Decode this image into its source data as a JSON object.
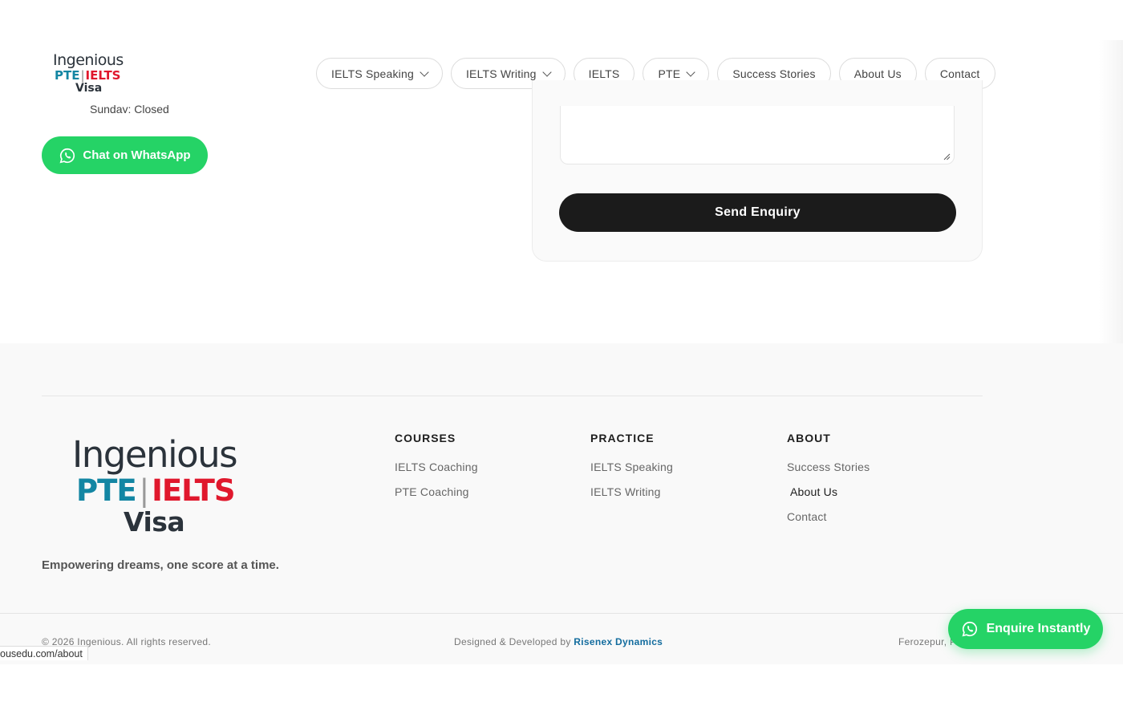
{
  "brand": {
    "line1": "Ingenious",
    "pte": "PTE",
    "separator": "|",
    "ielts": "IELTS",
    "line3": "Visa"
  },
  "nav": {
    "items": [
      {
        "label": "IELTS Speaking",
        "dropdown": true
      },
      {
        "label": "IELTS Writing",
        "dropdown": true
      },
      {
        "label": "IELTS",
        "dropdown": false
      },
      {
        "label": "PTE",
        "dropdown": true
      },
      {
        "label": "Success Stories",
        "dropdown": false
      },
      {
        "label": "About Us",
        "dropdown": false
      },
      {
        "label": "Contact",
        "dropdown": false
      }
    ]
  },
  "contact": {
    "hours_sunday": "Sunday: Closed",
    "whatsapp_label": "Chat on WhatsApp"
  },
  "form": {
    "message_value": "",
    "submit_label": "Send Enquiry"
  },
  "footer": {
    "tagline": "Empowering dreams, one score at a time.",
    "columns": {
      "courses": {
        "heading": "COURSES",
        "links": [
          "IELTS Coaching",
          "PTE Coaching"
        ]
      },
      "practice": {
        "heading": "PRACTICE",
        "links": [
          "IELTS Speaking",
          "IELTS Writing"
        ]
      },
      "about": {
        "heading": "ABOUT",
        "links": [
          "Success Stories",
          "About Us",
          "Contact"
        ]
      }
    },
    "copyright": "© 2026 Ingenious. All rights reserved.",
    "credit_prefix": "Designed & Developed by",
    "credit_link": "Risenex Dynamics",
    "location": "Ferozepur, P"
  },
  "floating": {
    "enquire_label": "Enquire Instantly"
  },
  "status_bar": {
    "url": "ousedu.com/about"
  },
  "colors": {
    "whatsapp_green": "#25d366",
    "brand_teal": "#1386a3",
    "brand_red": "#e0182d",
    "dark_button": "#1b1b1b",
    "credit_link": "#136c9e"
  }
}
